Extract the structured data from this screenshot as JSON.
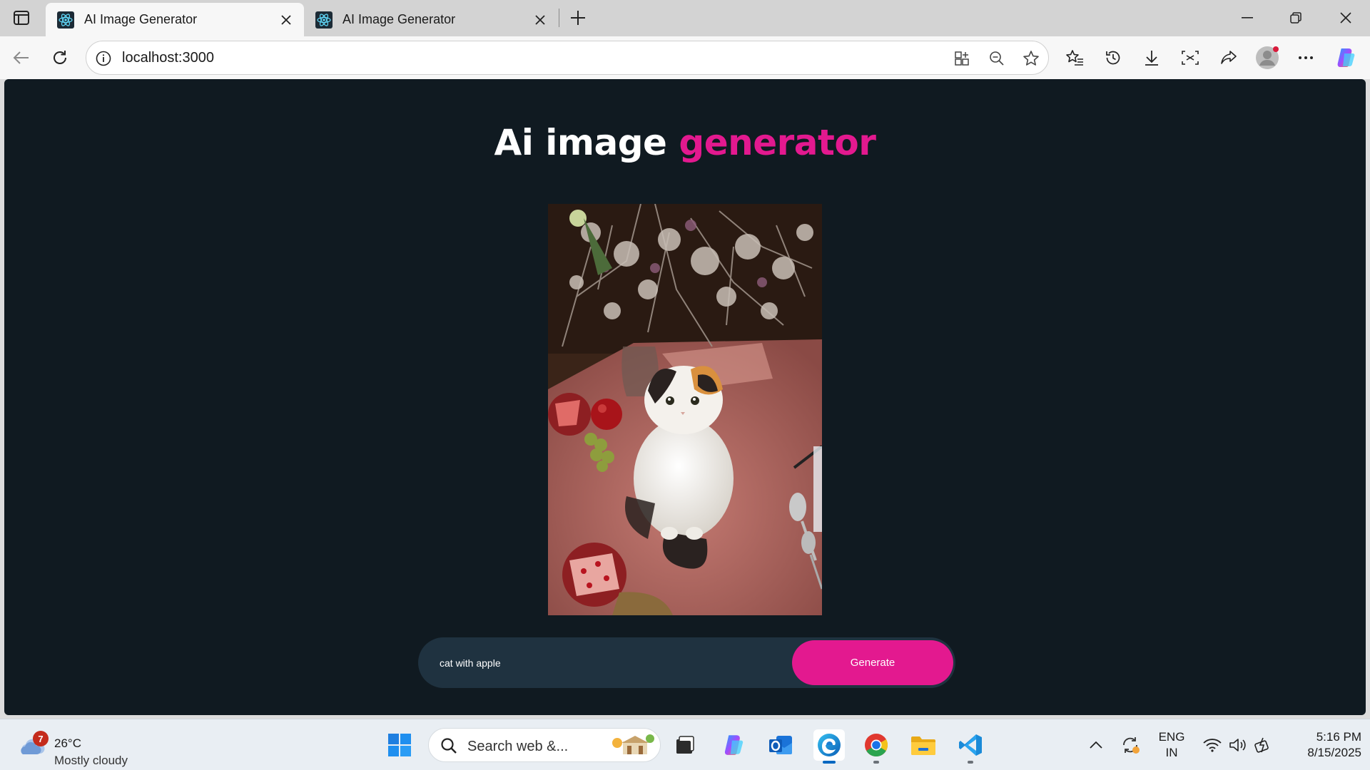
{
  "browser": {
    "tabs": [
      {
        "title": "AI Image Generator",
        "active": true
      },
      {
        "title": "AI Image Generator",
        "active": false
      }
    ],
    "address": "localhost:3000"
  },
  "page": {
    "heading_main": "Ai image",
    "heading_accent": "generator",
    "accent_color": "#e3198f",
    "background_color": "#101a21",
    "image_alt": "Generated image: cat sitting on a table with apple, pomegranate and flowers",
    "prompt_value": "cat with apple",
    "generate_label": "Generate"
  },
  "taskbar": {
    "weather": {
      "badge": "7",
      "temp": "26°C",
      "condition": "Mostly cloudy"
    },
    "search_placeholder": "Search web &...",
    "lang_line1": "ENG",
    "lang_line2": "IN",
    "time": "5:16 PM",
    "date": "8/15/2025",
    "apps": [
      "start-icon",
      "search-icon",
      "file-manager-icon",
      "copilot-icon",
      "outlook-icon",
      "edge-icon",
      "chrome-icon",
      "file-explorer-icon",
      "vscode-icon"
    ]
  }
}
